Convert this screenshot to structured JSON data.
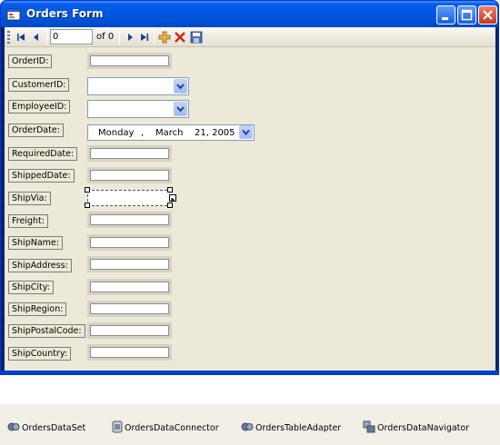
{
  "window": {
    "title": "Orders Form"
  },
  "navigator": {
    "position_value": "0",
    "count_label": "of 0"
  },
  "fields": {
    "order_id": "OrderID:",
    "customer_id": "CustomerID:",
    "employee_id": "EmployeeID:",
    "order_date": "OrderDate:",
    "required_date": "RequiredDate:",
    "shipped_date": "ShippedDate:",
    "ship_via": "ShipVia:",
    "freight": "Freight:",
    "ship_name": "ShipName:",
    "ship_address": "ShipAddress:",
    "ship_city": "ShipCity:",
    "ship_region": "ShipRegion:",
    "ship_postal_code": "ShipPostalCode:",
    "ship_country": "ShipCountry:"
  },
  "order_date_picker": {
    "day": "Monday",
    "sep": ",",
    "month": "March",
    "date_year": "21, 2005"
  },
  "tray": {
    "dataset": "OrdersDataSet",
    "connector": "OrdersDataConnector",
    "adapter": "OrdersTableAdapter",
    "navigator": "OrdersDataNavigator"
  }
}
